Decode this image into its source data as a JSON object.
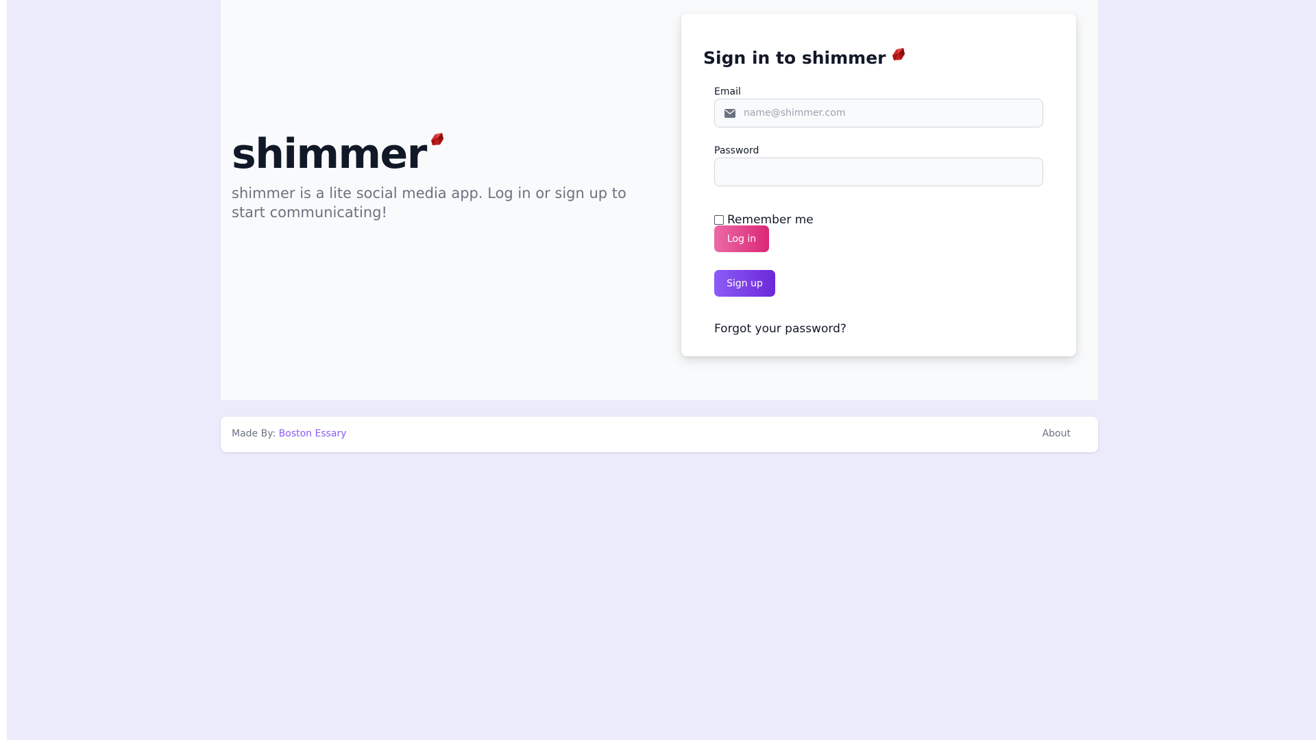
{
  "brand": {
    "name": "shimmer",
    "tagline": "shimmer is a lite social media app. Log in or sign up to start communicating!",
    "icon": "ruby-gem-icon"
  },
  "signin": {
    "title": "Sign in to shimmer",
    "email_label": "Email",
    "email_placeholder": "name@shimmer.com",
    "email_value": "",
    "password_label": "Password",
    "password_value": "",
    "remember_label": "Remember me",
    "remember_checked": false,
    "login_label": "Log in",
    "signup_label": "Sign up",
    "forgot_label": "Forgot your password?"
  },
  "footer": {
    "made_by_label": "Made By:",
    "author": "Boston Essary",
    "about_label": "About"
  },
  "colors": {
    "page_background": "#ebebfc",
    "hero_background": "#f9fafb",
    "login_gradient": [
      "#ec6aa5",
      "#db2777"
    ],
    "signup_gradient": [
      "#8b5cf6",
      "#6d28d9"
    ],
    "link": "#8b5cf6",
    "ruby": "#b91c1c"
  }
}
